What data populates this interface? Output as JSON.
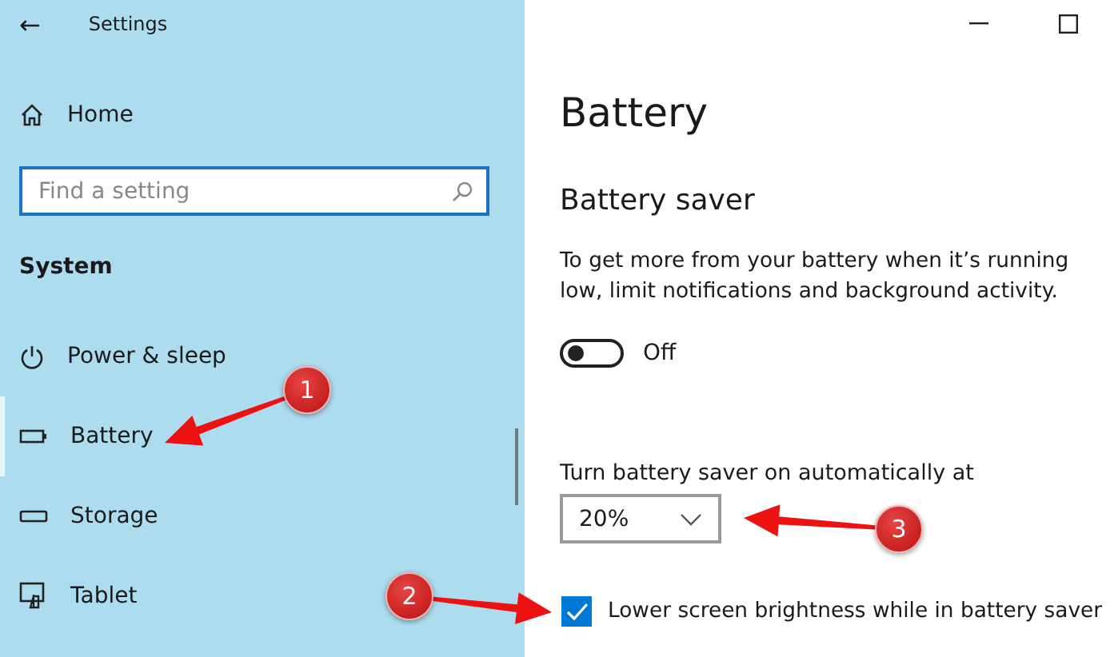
{
  "window": {
    "title": "Settings",
    "back_glyph": "←"
  },
  "sidebar": {
    "home": "Home",
    "search": {
      "placeholder": "Find a setting"
    },
    "section": "System",
    "items": [
      {
        "label": "Power & sleep",
        "kind": "power",
        "selected": false
      },
      {
        "label": "Battery",
        "kind": "battery",
        "selected": true
      },
      {
        "label": "Storage",
        "kind": "storage",
        "selected": false
      },
      {
        "label": "Tablet",
        "kind": "tablet",
        "selected": false
      }
    ]
  },
  "content": {
    "title": "Battery",
    "section": "Battery saver",
    "description": "To get more from your battery when it’s running low, limit notifications and background activity.",
    "toggle": {
      "on": false,
      "label": "Off"
    },
    "auto_label": "Turn battery saver on automatically at",
    "dropdown": {
      "value": "20%"
    },
    "checkbox": {
      "label": "Lower screen brightness while in battery saver",
      "checked": true
    }
  },
  "annotations": [
    {
      "number": "1"
    },
    {
      "number": "2"
    },
    {
      "number": "3"
    }
  ]
}
